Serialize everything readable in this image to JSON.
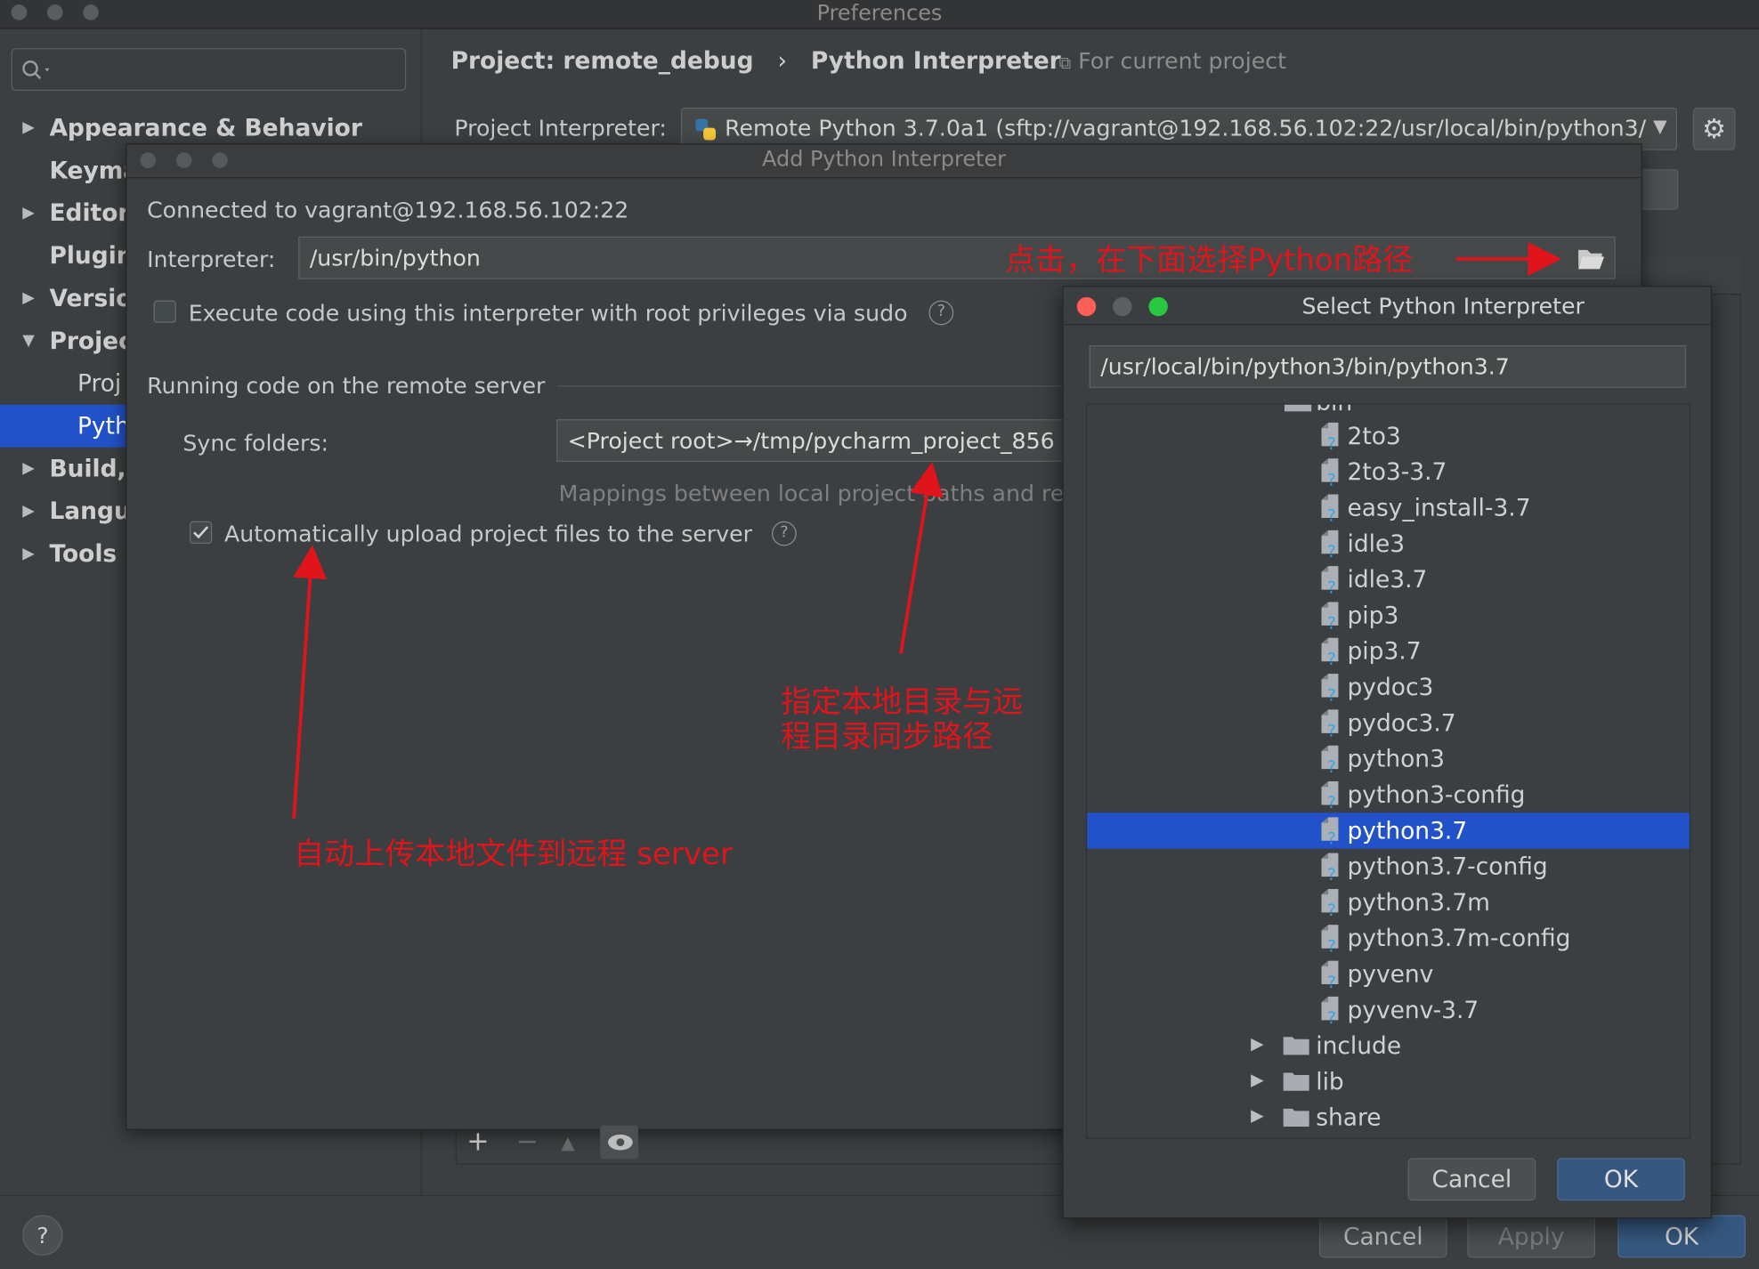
{
  "window": {
    "title": "Preferences"
  },
  "search": {
    "placeholder": ""
  },
  "sidebar": {
    "items": [
      {
        "label": "Appearance & Behavior",
        "arrow": "▶"
      },
      {
        "label": "Keyma",
        "arrow": ""
      },
      {
        "label": "Editor",
        "arrow": "▶"
      },
      {
        "label": "Plugin",
        "arrow": ""
      },
      {
        "label": "Versio",
        "arrow": "▶"
      },
      {
        "label": "Projec",
        "arrow": "▼"
      },
      {
        "label": "Proj",
        "arrow": ""
      },
      {
        "label": "Pyth",
        "arrow": ""
      },
      {
        "label": "Build,",
        "arrow": "▶"
      },
      {
        "label": "Langu",
        "arrow": "▶"
      },
      {
        "label": "Tools",
        "arrow": "▶"
      }
    ]
  },
  "header": {
    "breadcrumb_project": "Project: remote_debug",
    "breadcrumb_sep": "›",
    "breadcrumb_page": "Python Interpreter",
    "scope": "For current project",
    "interpreter_label": "Project Interpreter:",
    "interpreter_value": "Remote Python 3.7.0a1 (sftp://vagrant@192.168.56.102:22/usr/local/bin/python3/"
  },
  "footer": {
    "cancel": "Cancel",
    "apply": "Apply",
    "ok": "OK",
    "help": "?"
  },
  "add_dialog": {
    "title": "Add Python Interpreter",
    "connected": "Connected to vagrant@192.168.56.102:22",
    "interpreter_label": "Interpreter:",
    "interpreter_value": "/usr/bin/python",
    "sudo_label": "Execute code using this interpreter with root privileges via sudo",
    "sudo_checked": false,
    "section_title": "Running code on the remote server",
    "sync_label": "Sync folders:",
    "sync_value": "<Project root>→/tmp/pycharm_project_856",
    "mappings_hint": "Mappings between local project paths and re",
    "auto_upload_label": "Automatically upload project files to the server",
    "auto_upload_checked": true,
    "toolbar": {
      "add": "+",
      "remove": "−"
    }
  },
  "select_dialog": {
    "title": "Select Python Interpreter",
    "path": "/usr/local/bin/python3/bin/python3.7",
    "tree_parent": "bin",
    "files": [
      "2to3",
      "2to3-3.7",
      "easy_install-3.7",
      "idle3",
      "idle3.7",
      "pip3",
      "pip3.7",
      "pydoc3",
      "pydoc3.7",
      "python3",
      "python3-config",
      "python3.7",
      "python3.7-config",
      "python3.7m",
      "python3.7m-config",
      "pyvenv",
      "pyvenv-3.7"
    ],
    "selected": "python3.7",
    "folders": [
      "include",
      "lib",
      "share"
    ],
    "cancel": "Cancel",
    "ok": "OK"
  },
  "annotations": {
    "click_note": "点击，在下面选择Python路径",
    "sync_note_line1": "指定本地目录与远",
    "sync_note_line2": "程目录同步路径",
    "upload_note": "自动上传本地文件到远程 server"
  },
  "colors": {
    "selection": "#2152c9",
    "accent_ok": "#365880",
    "annotation": "#e0141b"
  }
}
